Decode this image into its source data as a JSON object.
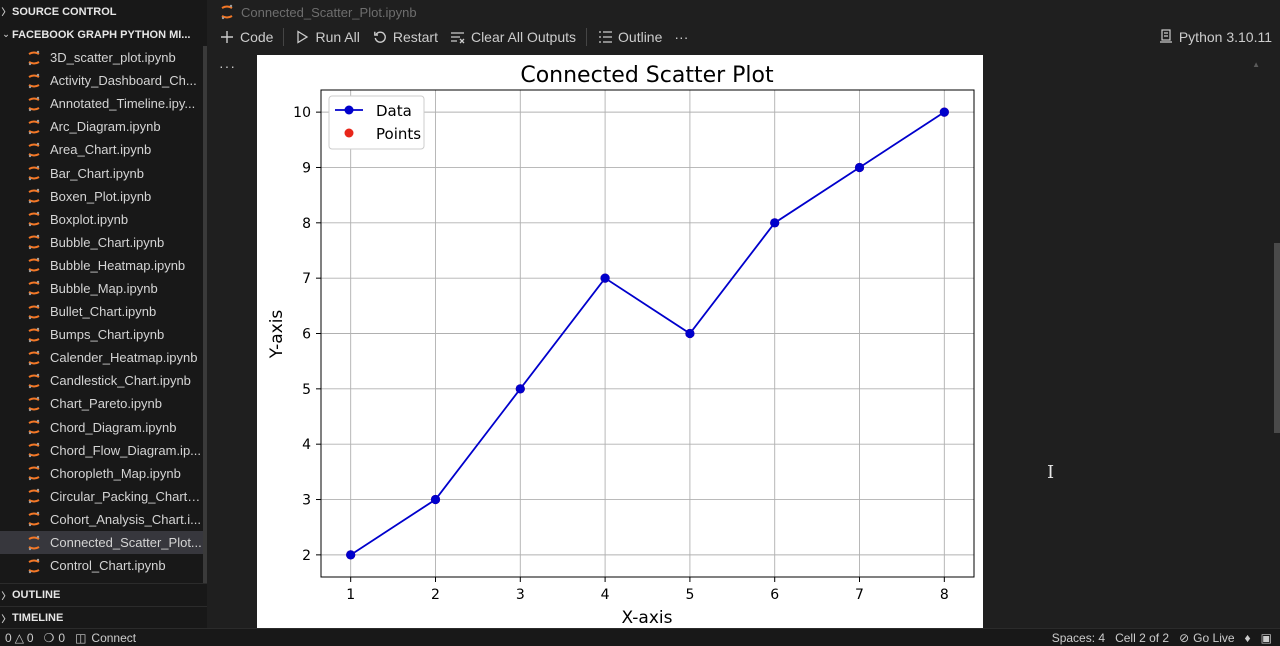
{
  "sidebar": {
    "source_control": "SOURCE CONTROL",
    "folder": "FACEBOOK GRAPH PYTHON MI...",
    "files": [
      "3D_scatter_plot.ipynb",
      "Activity_Dashboard_Ch...",
      "Annotated_Timeline.ipy...",
      "Arc_Diagram.ipynb",
      "Area_Chart.ipynb",
      "Bar_Chart.ipynb",
      "Boxen_Plot.ipynb",
      "Boxplot.ipynb",
      "Bubble_Chart.ipynb",
      "Bubble_Heatmap.ipynb",
      "Bubble_Map.ipynb",
      "Bullet_Chart.ipynb",
      "Bumps_Chart.ipynb",
      "Calender_Heatmap.ipynb",
      "Candlestick_Chart.ipynb",
      "Chart_Pareto.ipynb",
      "Chord_Diagram.ipynb",
      "Chord_Flow_Diagram.ip...",
      "Choropleth_Map.ipynb",
      "Circular_Packing_Chart.i...",
      "Cohort_Analysis_Chart.i...",
      "Connected_Scatter_Plot...",
      "Control_Chart.ipynb"
    ],
    "active_index": 21,
    "outline": "OUTLINE",
    "timeline": "TIMELINE"
  },
  "tab": {
    "label": "Connected_Scatter_Plot.ipynb",
    "icon": "notebook-icon"
  },
  "toolbar": {
    "code": "Code",
    "run_all": "Run All",
    "restart": "Restart",
    "clear_outputs": "Clear All Outputs",
    "outline": "Outline",
    "more": "···",
    "kernel": "Python 3.10.11"
  },
  "cell": {
    "more": "···"
  },
  "statusbar": {
    "errors": "0",
    "warnings": "0",
    "ports": "0",
    "connect": "Connect",
    "spaces": "Spaces: 4",
    "cell": "Cell 2 of 2",
    "go_live": "Go Live"
  },
  "colors": {
    "line": "#0000cc",
    "points": "#e8261a",
    "notebook_icon": "#f37726"
  },
  "chart_data": {
    "type": "line",
    "title": "Connected Scatter Plot",
    "xlabel": "X-axis",
    "ylabel": "Y-axis",
    "x": [
      1,
      2,
      3,
      4,
      5,
      6,
      7,
      8
    ],
    "series": [
      {
        "name": "Data",
        "values": [
          2,
          3,
          5,
          7,
          6,
          8,
          9,
          10
        ],
        "marker": "circle",
        "color": "#0000cc"
      },
      {
        "name": "Points",
        "values": [
          2,
          3,
          5,
          7,
          6,
          8,
          9,
          10
        ],
        "marker": "circle",
        "color": "#e8261a"
      }
    ],
    "xticks": [
      "1",
      "2",
      "3",
      "4",
      "5",
      "6",
      "7",
      "8"
    ],
    "yticks": [
      "2",
      "3",
      "4",
      "5",
      "6",
      "7",
      "8",
      "9",
      "10"
    ],
    "xlim": [
      0.65,
      8.35
    ],
    "ylim": [
      1.6,
      10.4
    ],
    "grid": true,
    "legend": "top-left"
  }
}
